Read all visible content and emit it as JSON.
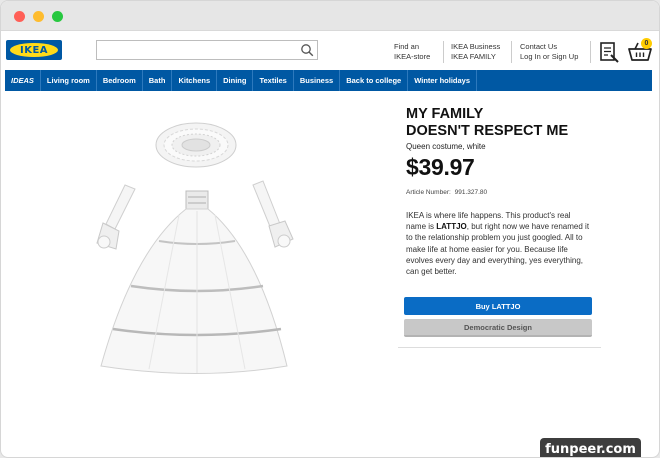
{
  "header": {
    "logo_text": "IKEA",
    "search": {
      "value": "",
      "placeholder": ""
    },
    "links": [
      {
        "line1": "Find an",
        "line2": "IKEA-store"
      },
      {
        "line1": "IKEA Business",
        "line2": "IKEA FAMILY"
      },
      {
        "line1": "Contact Us",
        "line2": "Log In or Sign Up"
      }
    ],
    "cart_count": "0",
    "icons": [
      "search-icon",
      "receipt-icon",
      "cart-icon"
    ]
  },
  "nav": {
    "items": [
      "IDEAS",
      "Living room",
      "Bedroom",
      "Bath",
      "Kitchens",
      "Dining",
      "Textiles",
      "Business",
      "Back to college",
      "Winter holidays"
    ]
  },
  "product": {
    "title_line1": "MY FAMILY",
    "title_line2": "DOESN'T RESPECT ME",
    "subtitle": "Queen costume, white",
    "price": "$39.97",
    "article_label": "Article Number:",
    "article_number": "991.327.80",
    "desc_before": "IKEA is where life happens. This product's real name is ",
    "desc_name": "LATTJO",
    "desc_after": ", but right now we have renamed it to the relationship problem you just googled. All to make life at home easier for you. Because life evolves every day and everything, yes everything, can get better.",
    "buy_label": "Buy LATTJO",
    "secondary_label": "Democratic Design"
  },
  "watermark": "funpeer.com",
  "colors": {
    "brand_blue": "#0058a3",
    "brand_yellow": "#ffda1a",
    "buy_button": "#0a6cc5",
    "secondary_button": "#c8c8c8"
  }
}
